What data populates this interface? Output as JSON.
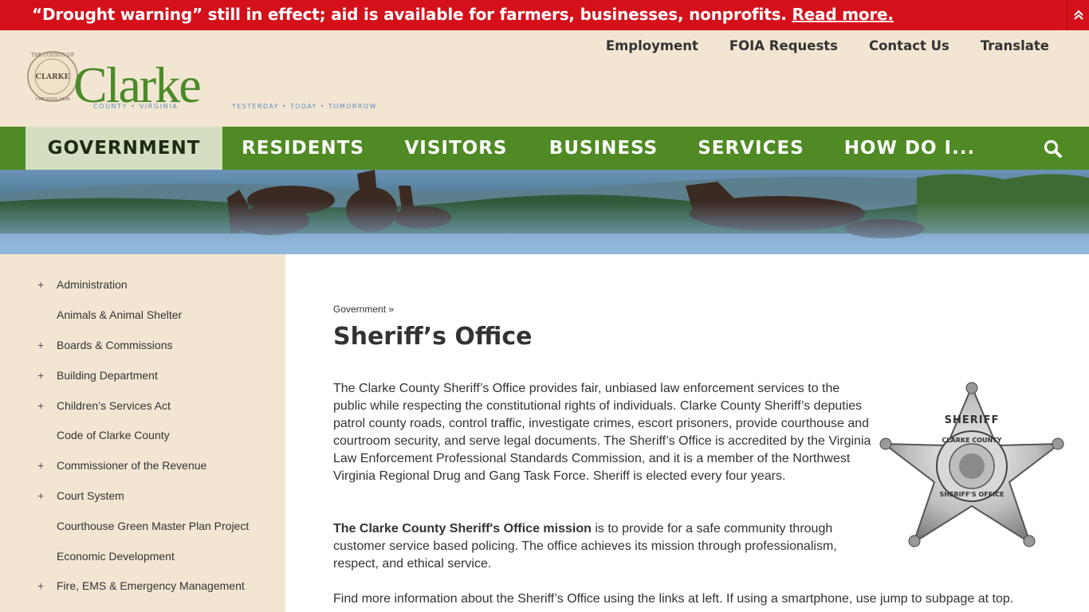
{
  "alert": {
    "message": "“Drought warning” still in effect; aid is available for farmers, businesses, nonprofits.",
    "link": "Read more."
  },
  "logo": {
    "seal_top": "THE COUNTY OF",
    "seal_middle": "CLARKE",
    "seal_bottom": "VIRGINIA 1836",
    "name": "Clarke",
    "subtitle": "COUNTY • VIRGINIA",
    "tagline": "YESTERDAY • TODAY • TOMORROW"
  },
  "utility_nav": [
    "Employment",
    "FOIA Requests",
    "Contact Us",
    "Translate"
  ],
  "main_nav": [
    "GOVERNMENT",
    "RESIDENTS",
    "VISITORS",
    "BUSINESS",
    "SERVICES",
    "HOW DO I..."
  ],
  "sidebar": {
    "items": [
      {
        "label": "Administration",
        "expandable": "+"
      },
      {
        "label": "Animals & Animal Shelter",
        "expandable": ""
      },
      {
        "label": "Boards & Commissions",
        "expandable": "+"
      },
      {
        "label": "Building Department",
        "expandable": "+"
      },
      {
        "label": "Children’s Services Act",
        "expandable": "+"
      },
      {
        "label": "Code of Clarke County",
        "expandable": ""
      },
      {
        "label": "Commissioner of the Revenue",
        "expandable": "+"
      },
      {
        "label": "Court System",
        "expandable": "+"
      },
      {
        "label": "Courthouse Green Master Plan Project",
        "expandable": ""
      },
      {
        "label": "Economic Development",
        "expandable": ""
      },
      {
        "label": "Fire, EMS & Emergency Management",
        "expandable": "+"
      }
    ]
  },
  "breadcrumb": "Government »",
  "page_title": "Sheriff’s Office",
  "content": {
    "p1": "The Clarke County Sheriff’s Office provides fair, unbiased law enforcement services to the public while respecting the constitutional rights of individuals. Clarke County Sheriff’s deputies patrol county roads, control traffic, investigate crimes, escort prisoners, provide courthouse and courtroom security, and serve legal documents. The Sheriff’s Office is accredited by the Virginia Law Enforcement Professional Standards Commission, and it is a member of the Northwest Virginia Regional Drug and Gang Task Force. Sheriff is elected every four years.",
    "p2_bold": "The Clarke County Sheriff's Office mission",
    "p2_rest": " is to provide for a safe community through customer service based policing. The office achieves its mission through professionalism, respect, and ethical service.",
    "p3": "Find more information about the Sheriff’s Office using the links at left. If using a smartphone, use jump to subpage at top."
  },
  "badge": {
    "top": "SHERIFF",
    "ring": "CLARKE COUNTY",
    "bottom": "SHERIFF'S OFFICE"
  },
  "colors": {
    "alert_red": "#d4111b",
    "nav_green": "#4f8a24",
    "nav_active": "#d3dfc0",
    "logo_green": "#4a8a2a",
    "sidebar_bg": "#f2e6d2"
  },
  "icons": {
    "alert_toggle": "double-chevron-up-icon",
    "search": "search-icon"
  }
}
